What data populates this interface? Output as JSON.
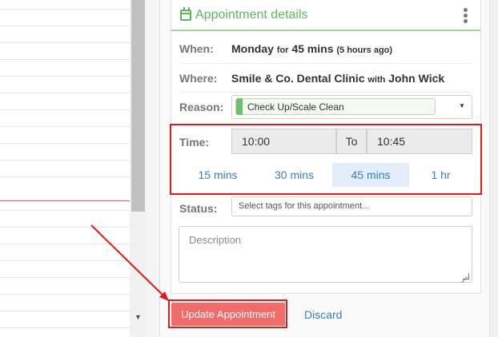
{
  "card": {
    "title": "Appointment details"
  },
  "when": {
    "label": "When:",
    "day": "Monday",
    "for_word": "for",
    "duration": "45 mins",
    "relative": "(5 hours ago)"
  },
  "where": {
    "label": "Where:",
    "clinic": "Smile & Co. Dental Clinic",
    "with_word": "with",
    "practitioner": "John Wick"
  },
  "reason": {
    "label": "Reason:",
    "selected": "Check Up/Scale Clean",
    "tag_color": "#6cc26a"
  },
  "time": {
    "label": "Time:",
    "start": "10:00",
    "to_label": "To",
    "end": "10:45"
  },
  "durations": {
    "options": [
      "15 mins",
      "30 mins",
      "45 mins",
      "1 hr"
    ],
    "selected": "45 mins"
  },
  "status": {
    "label": "Status:",
    "placeholder": "Select tags for this appointment..."
  },
  "description": {
    "placeholder": "Description"
  },
  "actions": {
    "update_label": "Update Appointment",
    "discard_label": "Discard"
  },
  "colors": {
    "accent_green": "#5cb85c",
    "update_button": "#f26b6b",
    "link_blue": "#3a7ec2",
    "highlight_red": "#e01b1b"
  }
}
